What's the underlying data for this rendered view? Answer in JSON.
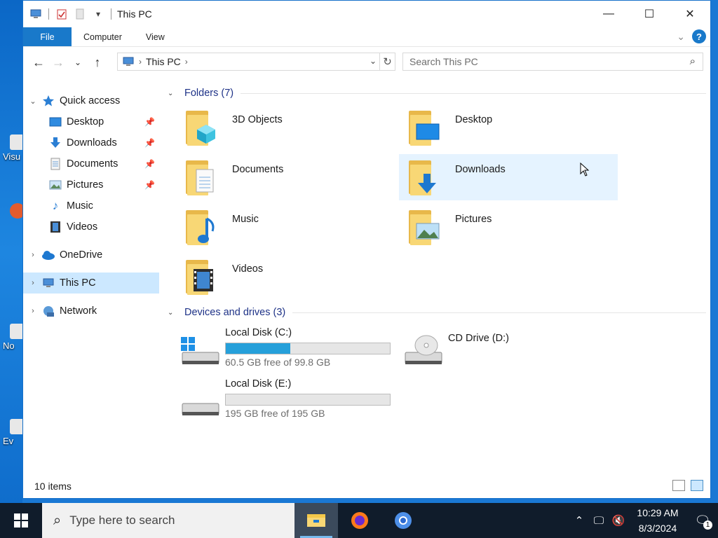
{
  "window": {
    "title": "This PC"
  },
  "ribbon": {
    "tabs": [
      "File",
      "Computer",
      "View"
    ],
    "help": "?"
  },
  "address": {
    "crumbs": [
      "This PC"
    ]
  },
  "search": {
    "placeholder": "Search This PC"
  },
  "sidebar": {
    "quick_access": "Quick access",
    "items": [
      {
        "label": "Desktop",
        "pinned": true
      },
      {
        "label": "Downloads",
        "pinned": true
      },
      {
        "label": "Documents",
        "pinned": true
      },
      {
        "label": "Pictures",
        "pinned": true
      },
      {
        "label": "Music",
        "pinned": false
      },
      {
        "label": "Videos",
        "pinned": false
      }
    ],
    "onedrive": "OneDrive",
    "thispc": "This PC",
    "network": "Network"
  },
  "folders": {
    "header": "Folders (7)",
    "items": [
      "3D Objects",
      "Desktop",
      "Documents",
      "Downloads",
      "Music",
      "Pictures",
      "Videos"
    ]
  },
  "drives": {
    "header": "Devices and drives (3)",
    "items": [
      {
        "name": "Local Disk (C:)",
        "free_text": "60.5 GB free of 99.8 GB",
        "used_fraction": 0.394
      },
      {
        "name": "CD Drive (D:)"
      },
      {
        "name": "Local Disk (E:)",
        "free_text": "195 GB free of 195 GB",
        "used_fraction": 0.0
      }
    ]
  },
  "status": {
    "count": "10 items"
  },
  "desktop": {
    "labels": [
      "Visu",
      "No",
      "Ev"
    ]
  },
  "taskbar": {
    "search_placeholder": "Type here to search",
    "time": "10:29 AM",
    "date": "8/3/2024",
    "notification_count": "1"
  },
  "colors": {
    "accent": "#1979ca",
    "selection": "#cce8ff",
    "hover": "#e5f3ff",
    "bar_fill": "#26a0da",
    "group_header": "#1e3287"
  }
}
